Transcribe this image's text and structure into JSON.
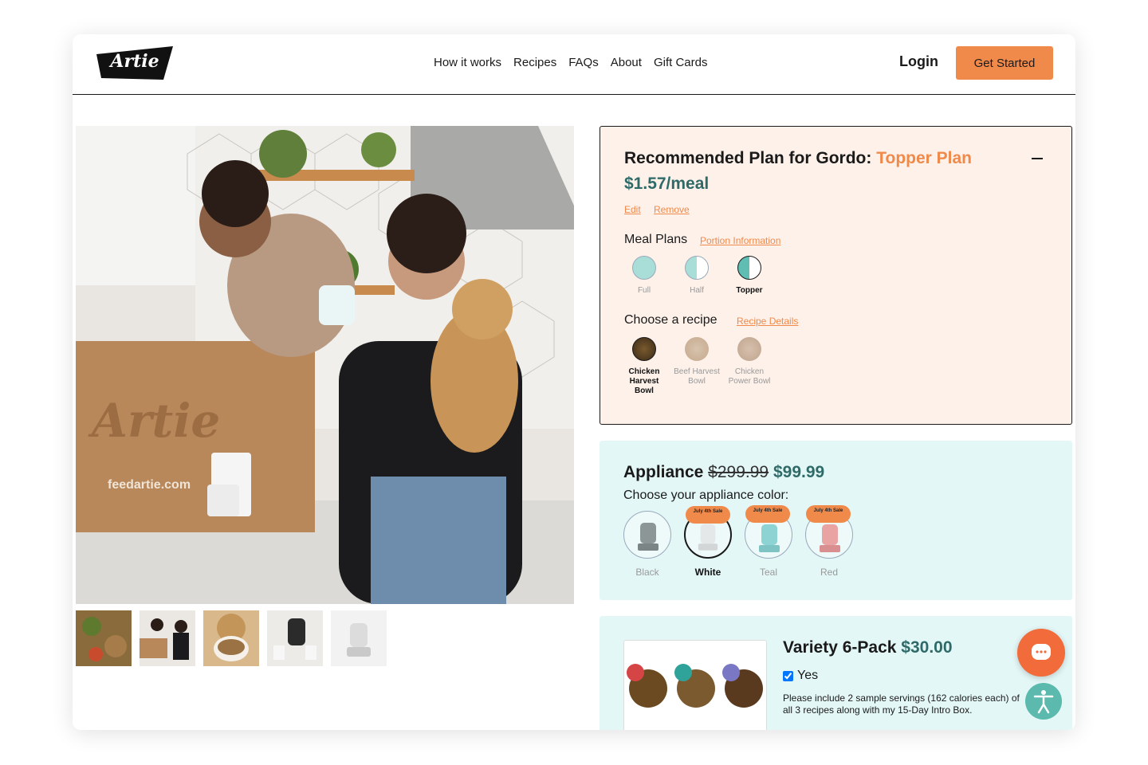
{
  "header": {
    "logo_text": "Artie",
    "nav": [
      "How it works",
      "Recipes",
      "FAQs",
      "About",
      "Gift Cards"
    ],
    "login_label": "Login",
    "cta_label": "Get Started"
  },
  "hero": {
    "box_brand": "Artie",
    "box_url": "feedartie.com",
    "thumbnails": [
      "food-thumb",
      "couple-box-thumb",
      "dog-bowl-thumb",
      "appliance-cups-thumb",
      "appliance-thumb"
    ]
  },
  "plan": {
    "title_prefix": "Recommended Plan for Gordo:",
    "title_accent": "Topper Plan",
    "price": "$1.57/meal",
    "edit_label": "Edit",
    "remove_label": "Remove",
    "meal_plans_label": "Meal Plans",
    "portion_link": "Portion Information",
    "meal_options": [
      "Full",
      "Half",
      "Topper"
    ],
    "selected_meal": "Topper",
    "recipe_label": "Choose a recipe",
    "recipe_link": "Recipe Details",
    "recipe_options": [
      "Chicken Harvest Bowl",
      "Beef Harvest Bowl",
      "Chicken Power Bowl"
    ],
    "selected_recipe": "Chicken Harvest Bowl"
  },
  "appliance": {
    "title": "Appliance",
    "old_price": "$299.99",
    "new_price": "$99.99",
    "color_prompt": "Choose your appliance color:",
    "colors": [
      "Black",
      "White",
      "Teal",
      "Red"
    ],
    "selected_color": "White",
    "sale_badge": "July 4th Sale"
  },
  "variety": {
    "title": "Variety 6-Pack",
    "price": "$30.00",
    "checkbox_label": "Yes",
    "checked": true,
    "description": "Please include 2 sample servings (162 calories each) of all 3 recipes along with my 15-Day Intro Box."
  },
  "colors": {
    "accent": "#f08a4b",
    "price_teal": "#2e6b68",
    "plan_bg": "#fdf1ea",
    "appliance_bg": "#e4f7f7",
    "chat": "#f26b3a",
    "accessibility": "#5bb9ad"
  },
  "icons": [
    "chat-icon",
    "accessibility-icon",
    "minus-icon"
  ]
}
